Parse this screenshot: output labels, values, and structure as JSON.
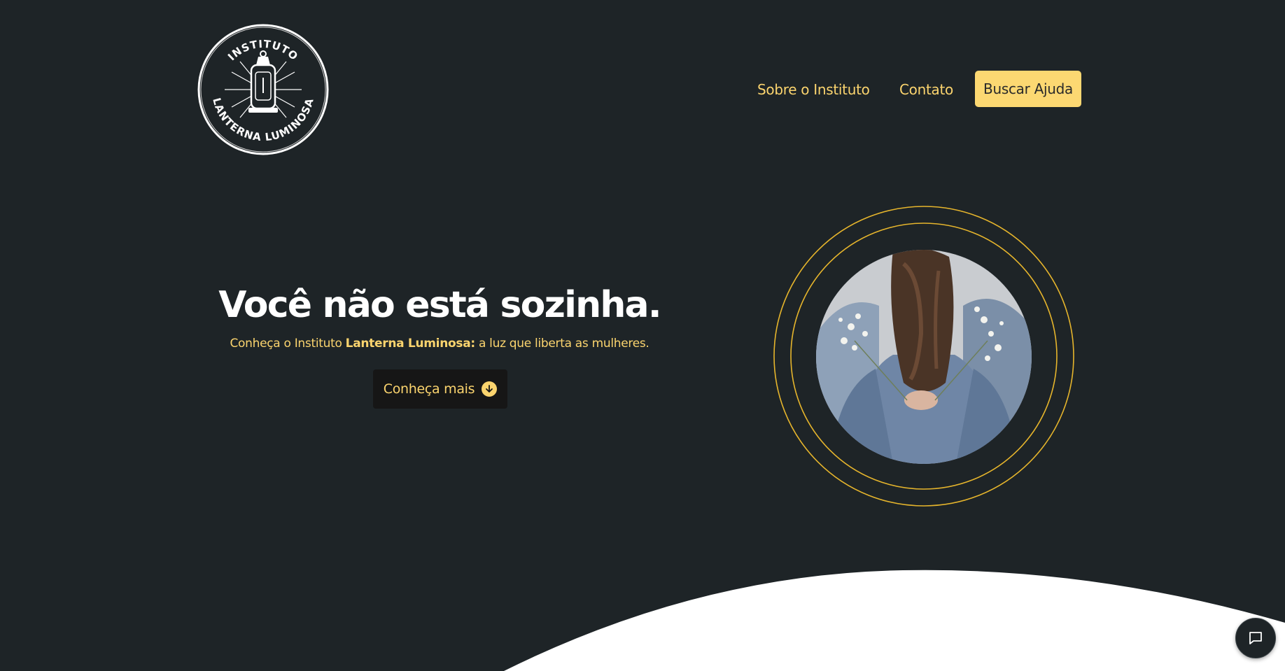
{
  "logo": {
    "top_text": "INSTITUTO",
    "bottom_text": "LANTERNA LUMINOSA"
  },
  "nav": {
    "about_label": "Sobre o Instituto",
    "contact_label": "Contato",
    "cta_label": "Buscar Ajuda"
  },
  "hero": {
    "title": "Você não está sozinha.",
    "subtitle_prefix": "Conheça o Instituto ",
    "subtitle_bold": "Lanterna Luminosa:",
    "subtitle_suffix": " a luz que liberta as mulheres.",
    "button_label": "Conheça mais"
  },
  "colors": {
    "background": "#1e2427",
    "accent": "#fbd46e",
    "button_bg": "#fcd872",
    "dark_button": "#161616"
  },
  "icons": {
    "download": "arrow-down-circle-icon",
    "chat": "chat-bubble-icon"
  }
}
